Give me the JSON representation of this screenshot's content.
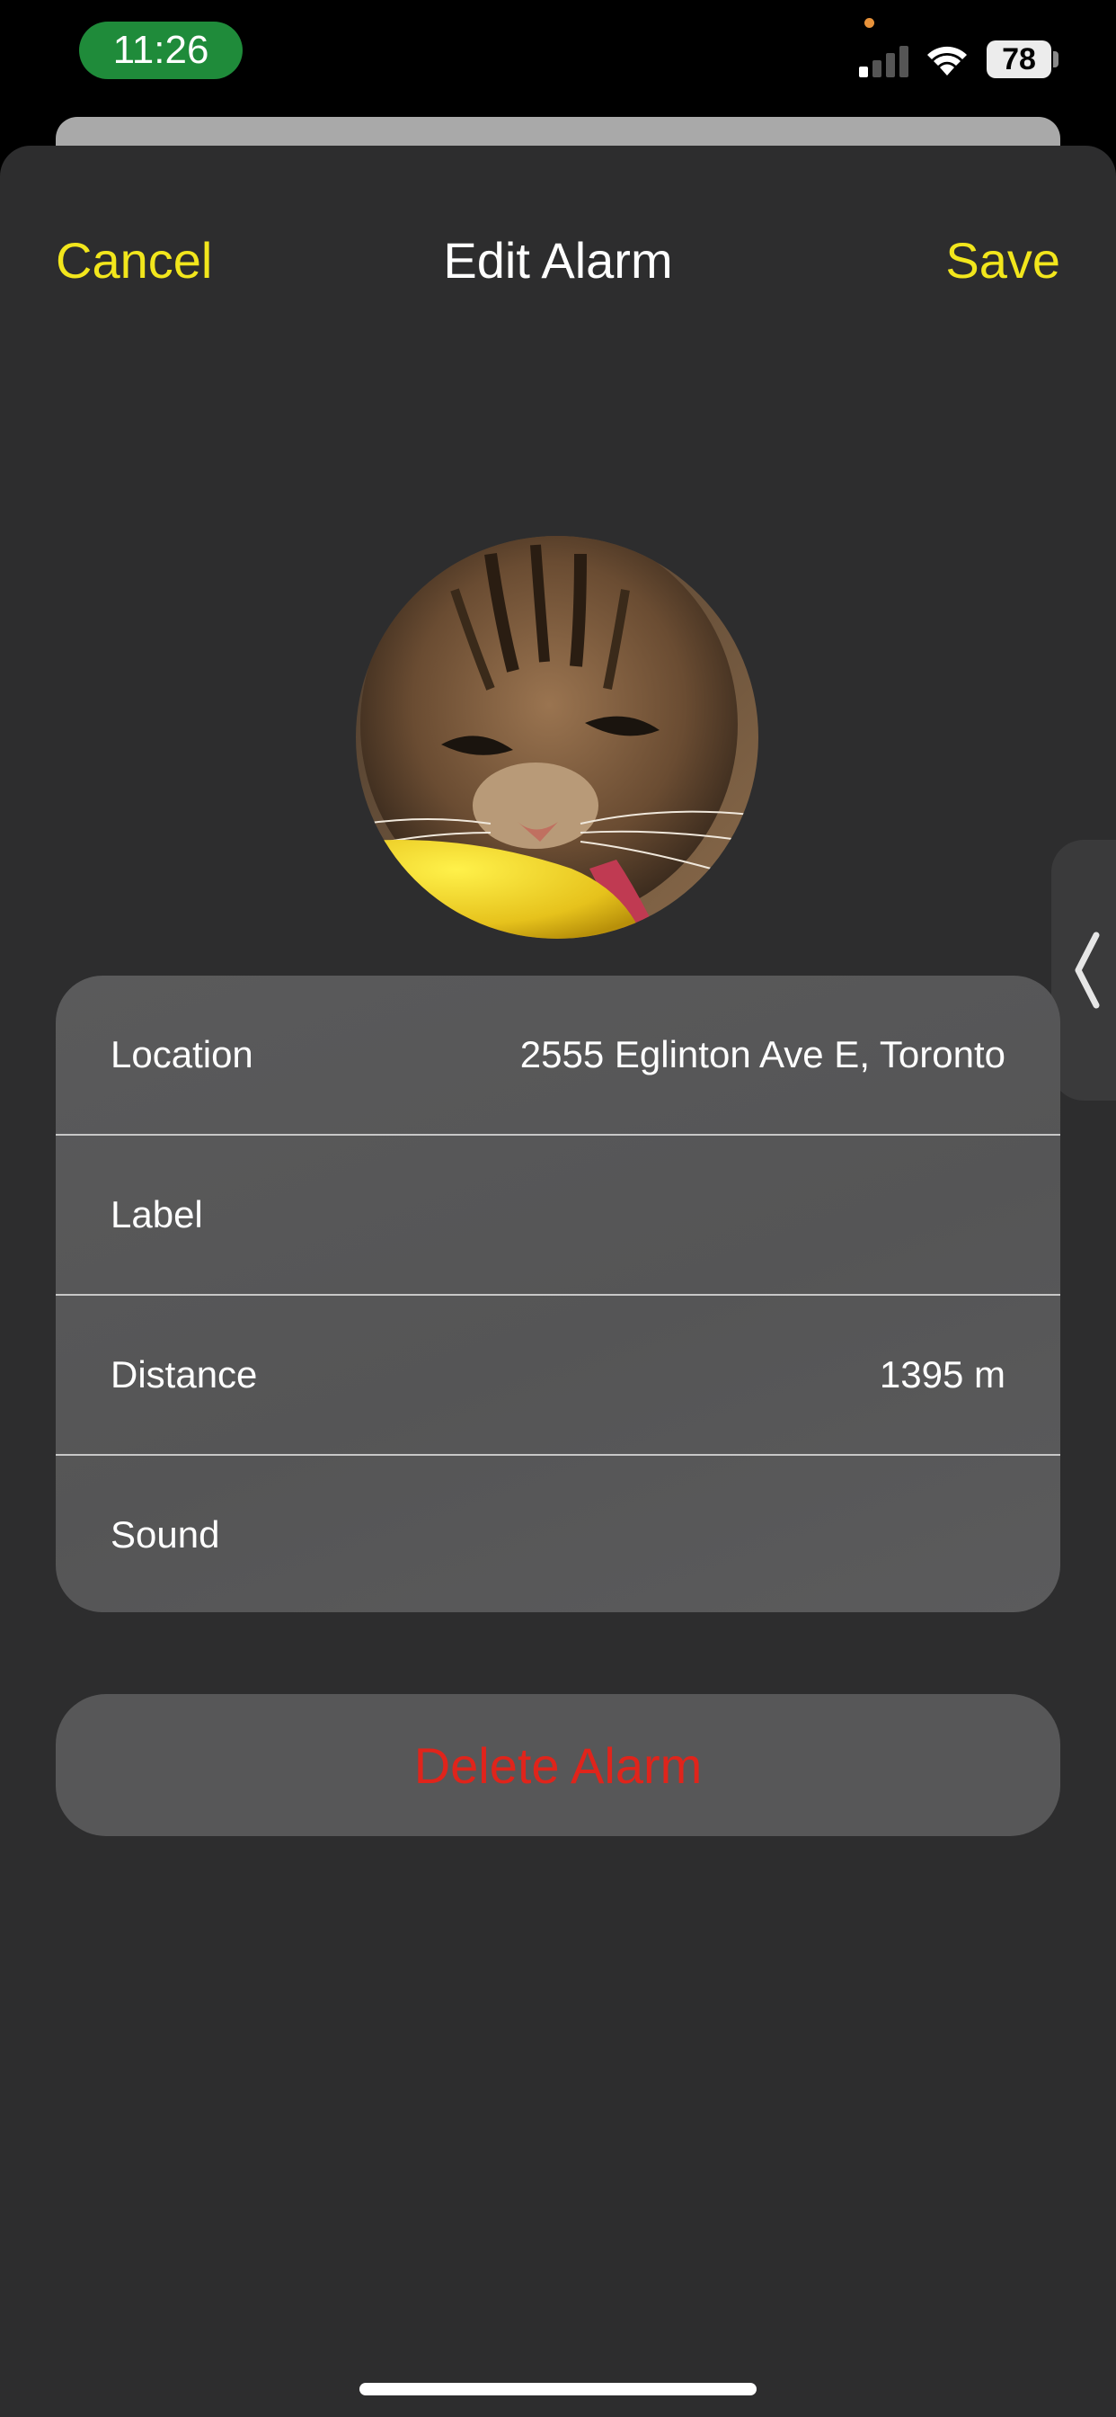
{
  "status_bar": {
    "time": "11:26",
    "battery": "78",
    "signal_icon": "cellular-signal-icon",
    "wifi_icon": "wifi-icon",
    "time_pill_color": "#1f8b3a"
  },
  "nav": {
    "cancel_label": "Cancel",
    "title": "Edit Alarm",
    "save_label": "Save"
  },
  "avatar": {
    "alt": "Tabby cat photo"
  },
  "settings": {
    "rows": [
      {
        "label": "Location",
        "value": "2555 Eglinton Ave E, Toronto"
      },
      {
        "label": "Label",
        "value": ""
      },
      {
        "label": "Distance",
        "value": "1395 m"
      },
      {
        "label": "Sound",
        "value": ""
      }
    ]
  },
  "actions": {
    "delete_label": "Delete Alarm"
  },
  "colors": {
    "accent": "#f2e61c",
    "destructive": "#e0241b",
    "sheet_background": "#2d2d2e",
    "card_background": "#585859"
  },
  "side_handle": {
    "icon": "chevron-left-icon"
  }
}
